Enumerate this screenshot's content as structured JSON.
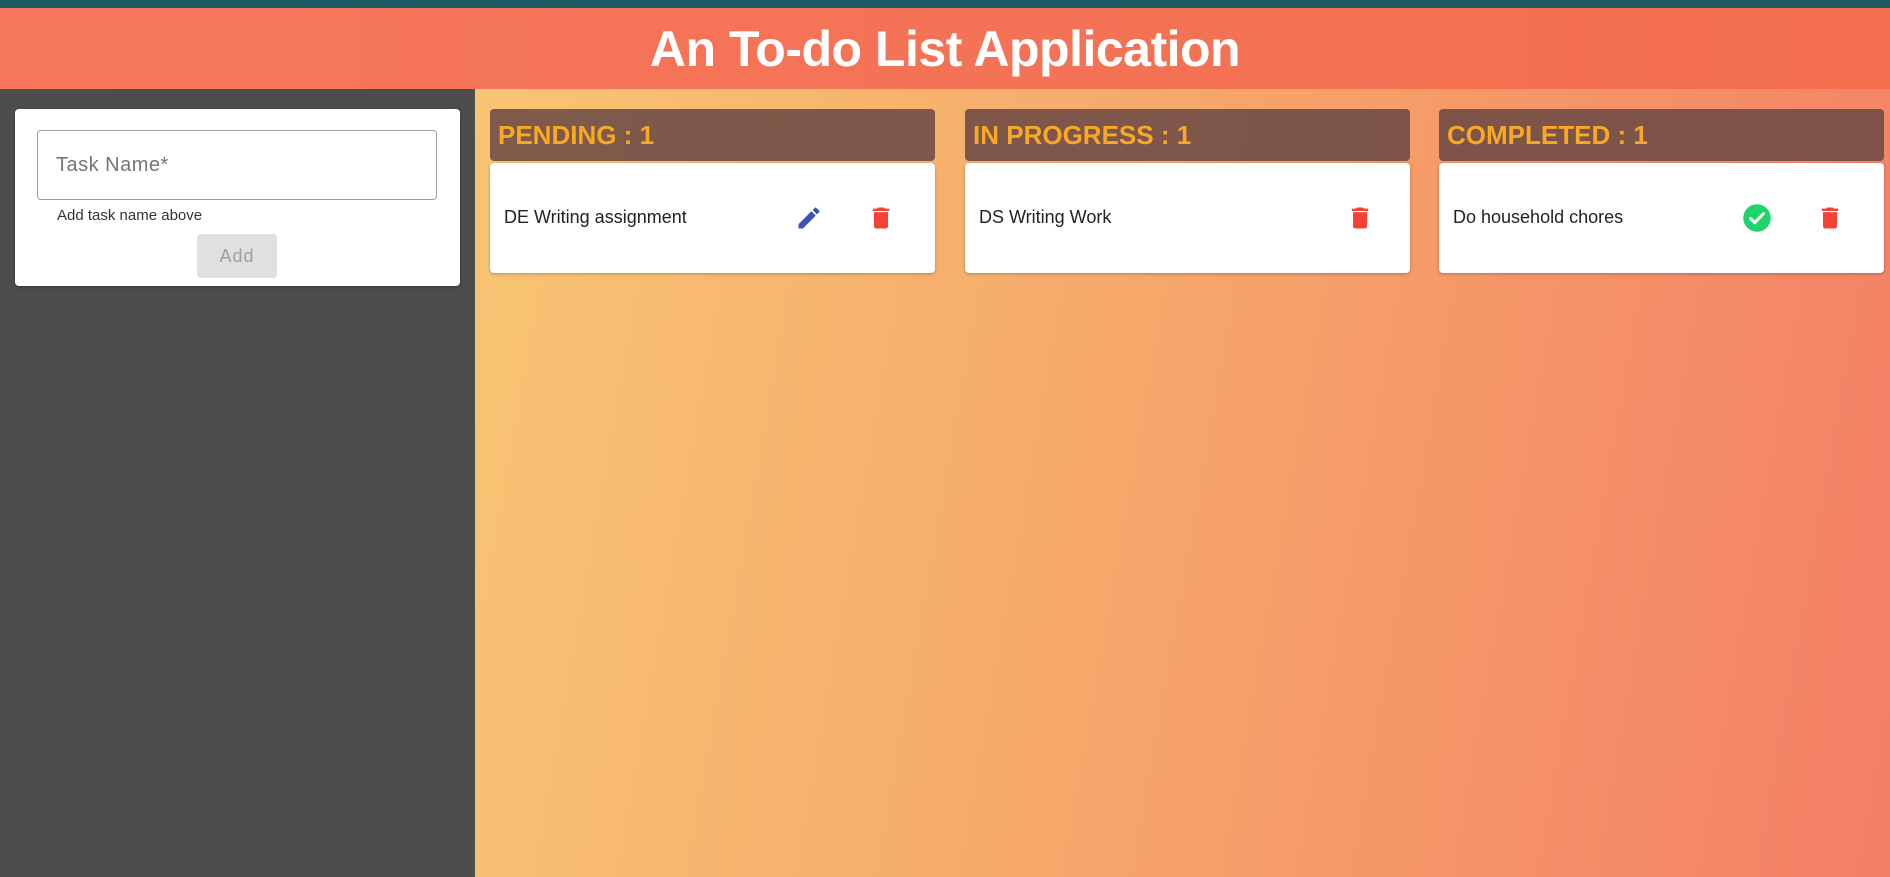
{
  "header": {
    "title": "An To-do List Application"
  },
  "form": {
    "placeholder": "Task Name*",
    "value": "",
    "helper": "Add task name above",
    "add_label": "Add"
  },
  "columns": [
    {
      "title": "PENDING : 1",
      "tasks": [
        {
          "name": "DE Writing assignment",
          "actions": [
            "edit-icon",
            "delete-icon"
          ]
        }
      ]
    },
    {
      "title": "IN PROGRESS : 1",
      "tasks": [
        {
          "name": "DS Writing Work",
          "actions": [
            "delete-icon"
          ]
        }
      ]
    },
    {
      "title": "COMPLETED : 1",
      "tasks": [
        {
          "name": "Do household chores",
          "actions": [
            "check-circle-icon",
            "delete-icon"
          ]
        }
      ]
    }
  ],
  "colors": {
    "header_bg": "#f47158",
    "topbar": "#1f5a62",
    "sidebar_bg": "#4d4d4d",
    "column_title": "#f9a826",
    "edit_icon": "#3f51b5",
    "delete_icon": "#f44336",
    "check_icon": "#1fd56b"
  }
}
